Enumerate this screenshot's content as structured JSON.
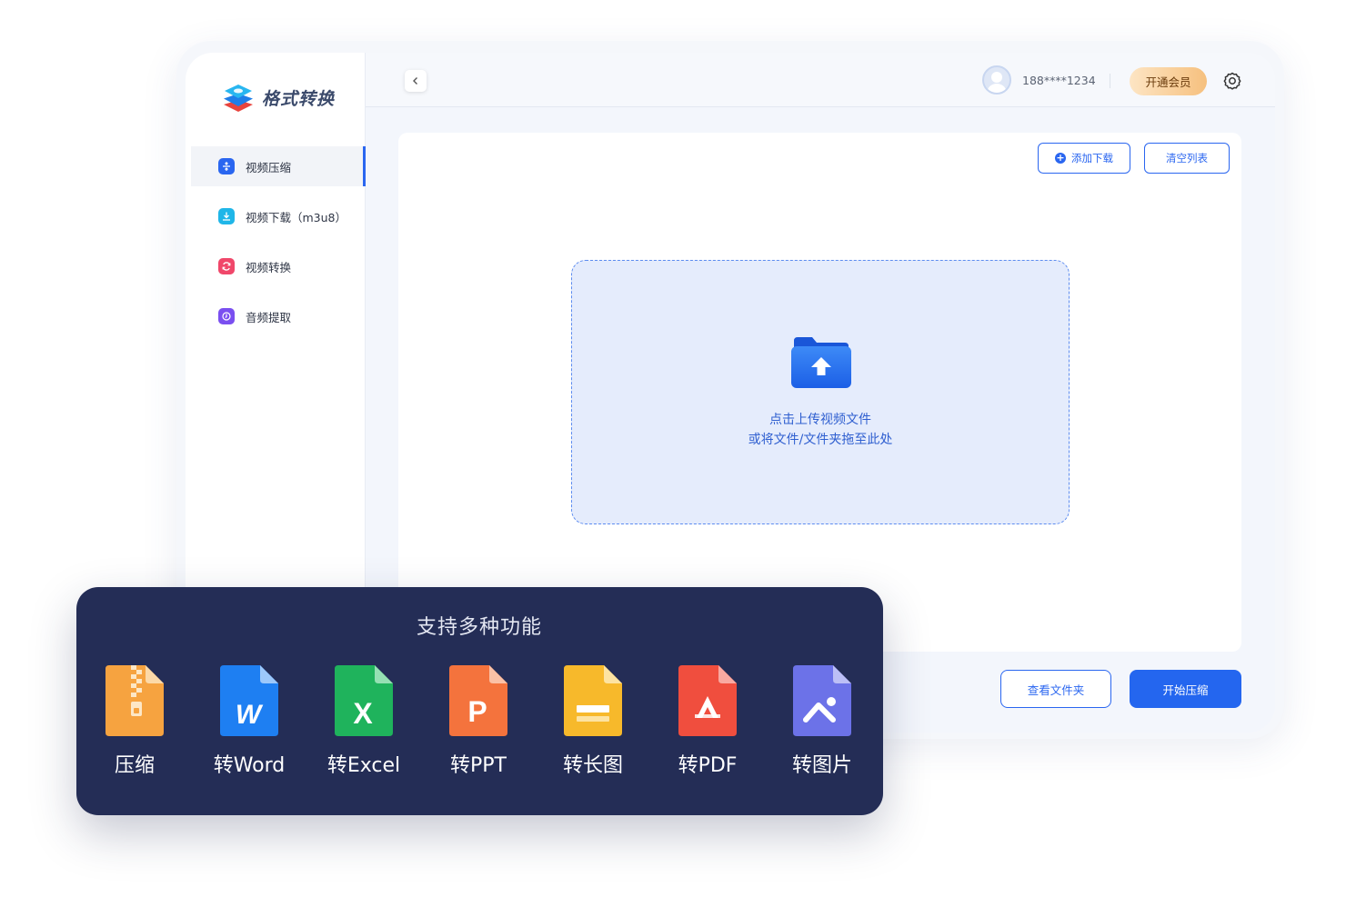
{
  "app": {
    "title": "格式转换"
  },
  "sidebar": {
    "items": [
      {
        "label": "视频压缩",
        "icon": "compress-icon",
        "color": "#2a66f0",
        "active": true
      },
      {
        "label": "视频下载（m3u8）",
        "icon": "download-icon",
        "color": "#1fb6e8",
        "active": false
      },
      {
        "label": "视频转换",
        "icon": "convert-icon",
        "color": "#f0476a",
        "active": false
      },
      {
        "label": "音频提取",
        "icon": "audio-icon",
        "color": "#7a4ff0",
        "active": false
      }
    ]
  },
  "header": {
    "phone": "188****1234",
    "vip_label": "开通会员"
  },
  "toolbar": {
    "add_label": "添加下载",
    "clear_label": "清空列表"
  },
  "dropzone": {
    "line1": "点击上传视频文件",
    "line2": "或将文件/文件夹拖至此处"
  },
  "footer": {
    "view_folder_label": "查看文件夹",
    "start_label": "开始压缩"
  },
  "features": {
    "title": "支持多种功能",
    "items": [
      {
        "label": "压缩",
        "icon": "zip-file-icon",
        "color": "#f6a340"
      },
      {
        "label": "转Word",
        "icon": "word-file-icon",
        "color": "#1e7ff2"
      },
      {
        "label": "转Excel",
        "icon": "excel-file-icon",
        "color": "#1fb35c"
      },
      {
        "label": "转PPT",
        "icon": "ppt-file-icon",
        "color": "#f4733d"
      },
      {
        "label": "转长图",
        "icon": "long-image-file-icon",
        "color": "#f7b92b"
      },
      {
        "label": "转PDF",
        "icon": "pdf-file-icon",
        "color": "#f04e3e"
      },
      {
        "label": "转图片",
        "icon": "image-file-icon",
        "color": "#6c72e8"
      }
    ]
  },
  "colors": {
    "accent": "#2a66f0",
    "card_bg": "#242d56"
  }
}
